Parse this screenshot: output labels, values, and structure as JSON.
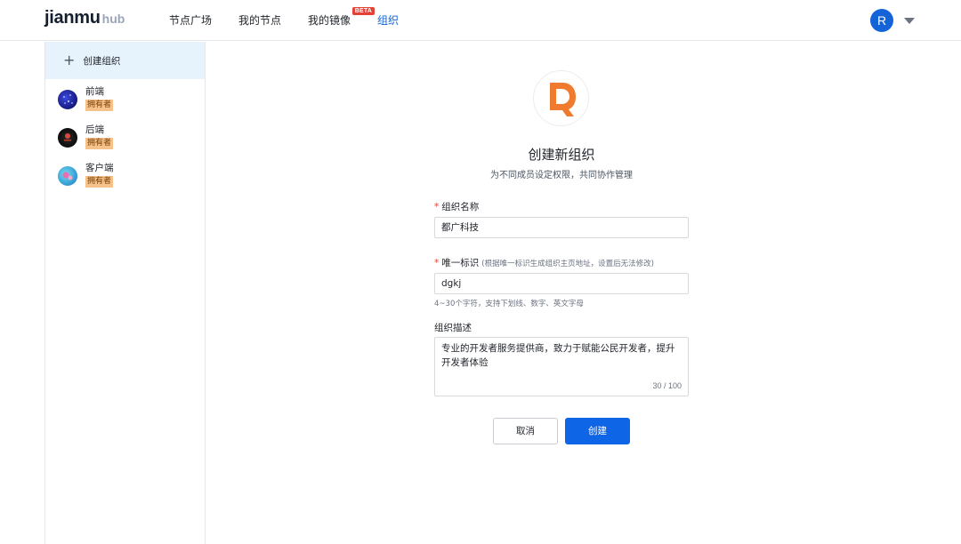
{
  "header": {
    "logo_main": "jianmu",
    "logo_sub": "hub",
    "nav": [
      {
        "label": "节点广场"
      },
      {
        "label": "我的节点"
      },
      {
        "label": "我的镜像",
        "badge": "BETA"
      },
      {
        "label": "组织",
        "active": true
      }
    ],
    "user_initial": "R",
    "colors": {
      "accent": "#1463d9",
      "badge": "#e34234"
    }
  },
  "sidebar": {
    "create_label": "创建组织",
    "orgs": [
      {
        "name": "前端",
        "role": "拥有者"
      },
      {
        "name": "后端",
        "role": "拥有者"
      },
      {
        "name": "客户端",
        "role": "拥有者"
      }
    ]
  },
  "form": {
    "title": "创建新组织",
    "subtitle": "为不同成员设定权限，共同协作管理",
    "name_label": "组织名称",
    "name_value": "都广科技",
    "id_label": "唯一标识",
    "id_hint": "(根据唯一标识生成组织主页地址，设置后无法修改)",
    "id_value": "dgkj",
    "id_help": "4~30个字符，支持下划线、数字、英文字母",
    "desc_label": "组织描述",
    "desc_value": "专业的开发者服务提供商，致力于赋能公民开发者，提升开发者体验",
    "desc_counter": "30 / 100",
    "cancel_label": "取消",
    "create_label": "创建",
    "colors": {
      "primary": "#0e66e6",
      "logo_orange": "#f07a2e"
    }
  }
}
